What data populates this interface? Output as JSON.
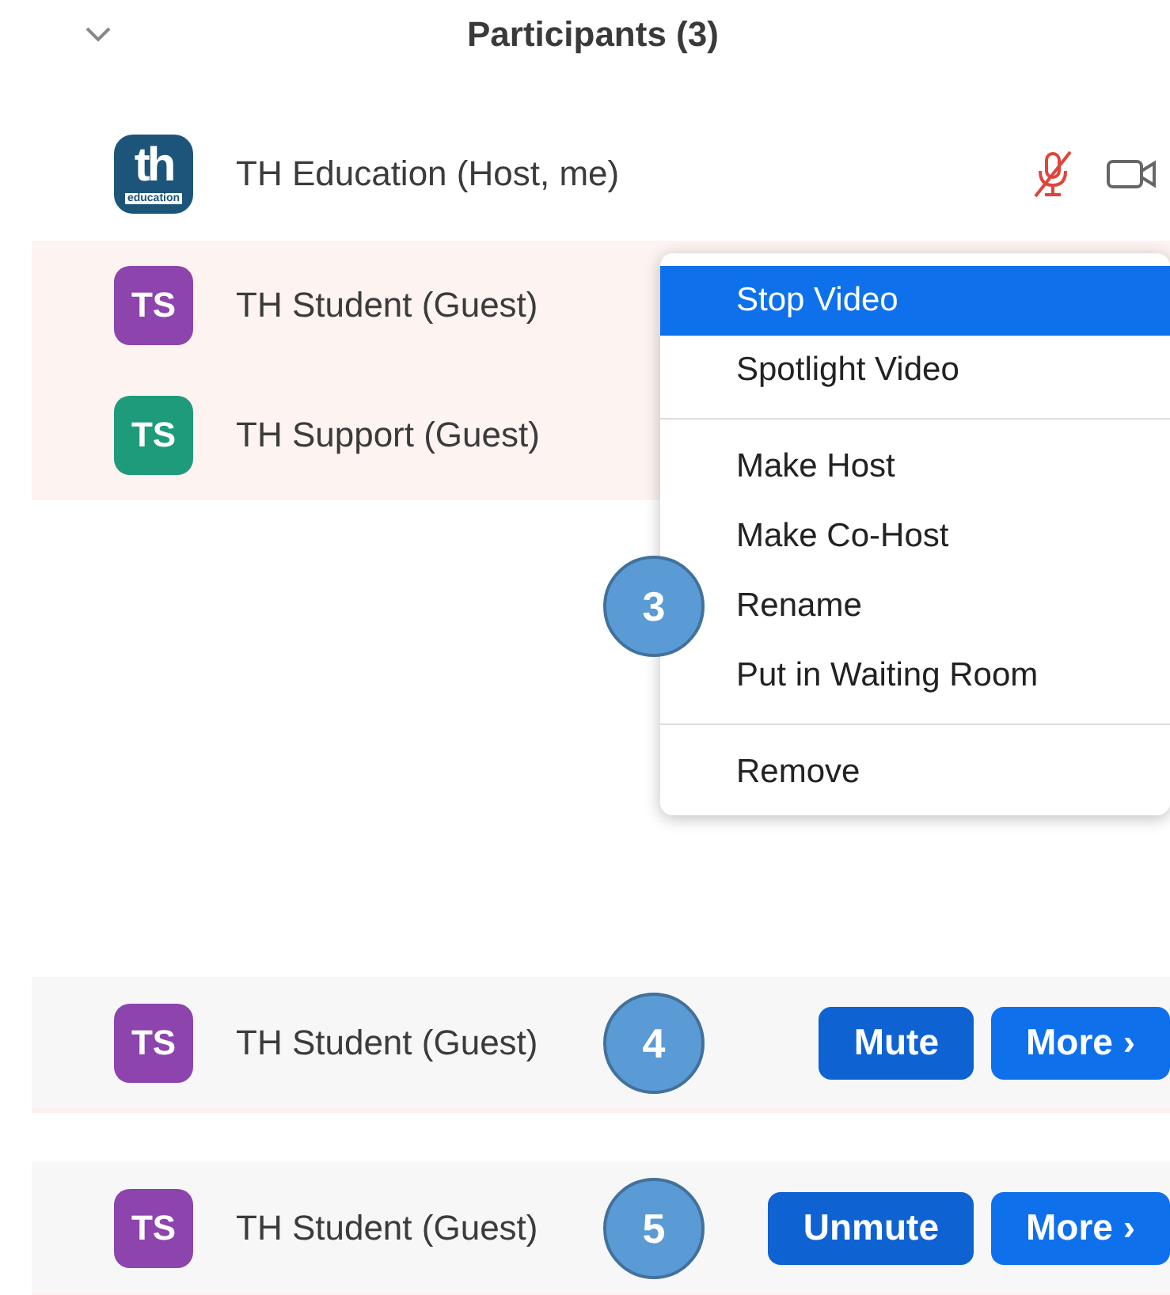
{
  "header": {
    "title": "Participants (3)"
  },
  "participants": [
    {
      "name": "TH Education (Host, me)",
      "avatar": {
        "kind": "logo",
        "text": "th",
        "subtext": "education",
        "color": "#1d5479"
      },
      "mic_muted": true,
      "video_on": true,
      "highlighted": false
    },
    {
      "name": "TH Student (Guest)",
      "avatar": {
        "kind": "initials",
        "text": "TS",
        "color": "#8e44ad"
      },
      "highlighted": true
    },
    {
      "name": "TH Support (Guest)",
      "avatar": {
        "kind": "initials",
        "text": "TS",
        "color": "#1e9b7b"
      },
      "highlighted": true
    }
  ],
  "context_menu": {
    "callout": "3",
    "groups": [
      [
        {
          "label": "Stop Video",
          "selected": true
        },
        {
          "label": "Spotlight Video",
          "selected": false
        }
      ],
      [
        {
          "label": "Make Host",
          "selected": false
        },
        {
          "label": "Make Co-Host",
          "selected": false
        },
        {
          "label": "Rename",
          "selected": false
        },
        {
          "label": "Put in Waiting Room",
          "selected": false
        }
      ],
      [
        {
          "label": "Remove",
          "selected": false
        }
      ]
    ]
  },
  "examples": [
    {
      "name": "TH Student (Guest)",
      "avatar": {
        "kind": "initials",
        "text": "TS",
        "color": "#8e44ad"
      },
      "callout": "4",
      "buttons": [
        {
          "label": "Mute",
          "kind": "primary"
        },
        {
          "label": "More ›",
          "kind": "secondary"
        }
      ]
    },
    {
      "name": "TH Student (Guest)",
      "avatar": {
        "kind": "initials",
        "text": "TS",
        "color": "#8e44ad"
      },
      "callout": "5",
      "buttons": [
        {
          "label": "Unmute",
          "kind": "primary"
        },
        {
          "label": "More ›",
          "kind": "secondary"
        }
      ]
    }
  ]
}
